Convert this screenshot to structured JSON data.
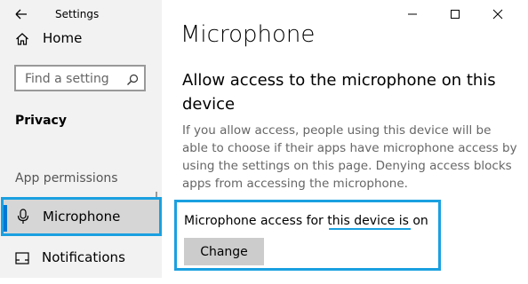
{
  "window": {
    "app_title": "Settings"
  },
  "sidebar": {
    "home_label": "Home",
    "search_placeholder": "Find a setting",
    "section_title": "Privacy",
    "group_label": "App permissions",
    "items": [
      {
        "label": "Microphone",
        "icon": "microphone-icon",
        "selected": true
      },
      {
        "label": "Notifications",
        "icon": "notifications-icon",
        "selected": false
      }
    ]
  },
  "main": {
    "page_title": "Microphone",
    "heading": "Allow access to the microphone on this device",
    "description": "If you allow access, people using this device will be able to choose if their apps have microphone access by using the settings on this page. Denying access blocks apps from accessing the microphone.",
    "status_text": "Microphone access for this device is on",
    "change_button_label": "Change"
  },
  "colors": {
    "accent": "#0078d7",
    "highlight": "#1aa0e0",
    "sidebar_bg": "#f2f2f2"
  }
}
